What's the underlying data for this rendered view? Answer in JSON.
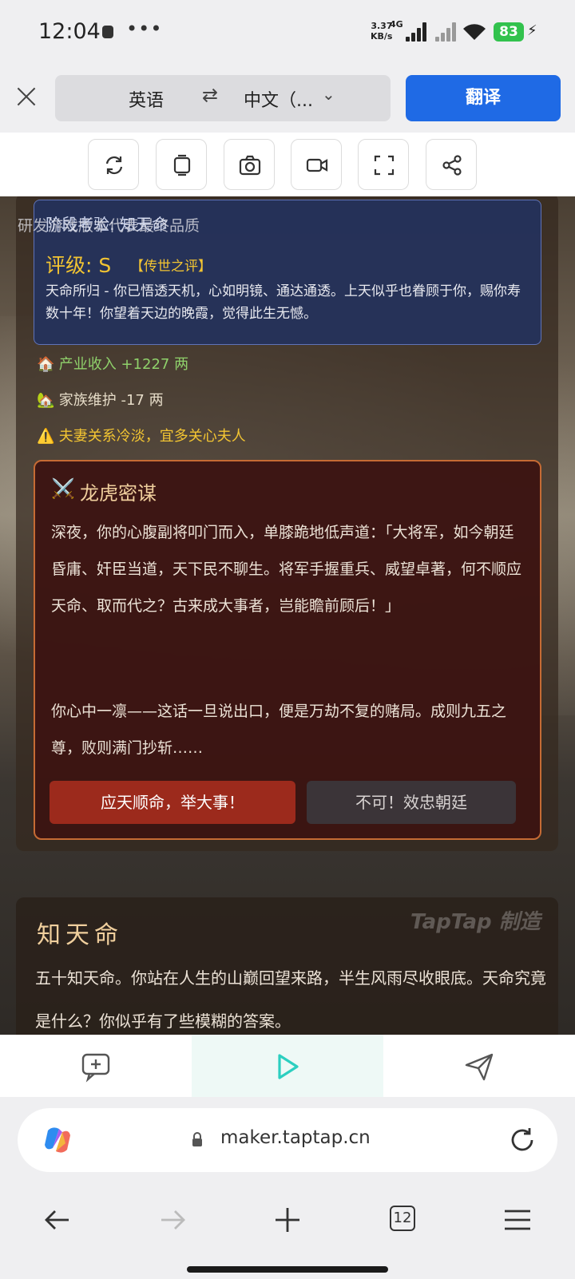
{
  "status_bar": {
    "time": "12:04",
    "more": "•••",
    "speed_top": "3.37",
    "speed_bottom": "KB/s",
    "network": "4G",
    "battery": "83",
    "battery_color": "#32c24d"
  },
  "translate_bar": {
    "source_lang": "英语",
    "swap_icon": "⇄",
    "target_lang": "中文（...",
    "translate_label": "翻译",
    "accent": "#1f6ae5"
  },
  "tools": [
    "refresh-icon",
    "layers-icon",
    "camera-icon",
    "video-icon",
    "fullscreen-icon",
    "share-icon"
  ],
  "game": {
    "watermark_top": "研发游戏版本代表最终品质",
    "evaluation": {
      "title": "阶段考验: 知天命",
      "grade": "评级: S",
      "grade_tag": "【传世之评】",
      "description": "天命所归 - 你已悟透天机，心如明镜、通达通透。上天似乎也眷顾于你，赐你寿数十年！你望着天边的晚霞，觉得此生无憾。"
    },
    "stats": {
      "income_icon": "🏠",
      "income": "产业收入 +1227 两",
      "family_icon": "🏡",
      "family": "家族维护 -17 两",
      "warning_icon": "⚠️",
      "warning": "夫妻关系冷淡，宜多关心夫人"
    },
    "event": {
      "icon": "⚔️",
      "title": "龙虎密谋",
      "paragraph1": "深夜，你的心腹副将叩门而入，单膝跪地低声道：「大将军，如今朝廷昏庸、奸臣当道，天下民不聊生。将军手握重兵、威望卓著，何不顺应天命、取而代之？古来成大事者，岂能瞻前顾后！」",
      "paragraph2": "你心中一凛——这话一旦说出口，便是万劫不复的赌局。成则九五之尊，败则满门抄斩……",
      "choice_a": "应天顺命，举大事！",
      "choice_b": "不可！效忠朝廷"
    },
    "chapter": {
      "title": "知天命",
      "text": "五十知天命。你站在人生的山巅回望来路，半生风雨尽收眼底。天命究竟是什么？你似乎有了些模糊的答案。"
    },
    "taptap_watermark": "TapTap 制造"
  },
  "app_bar": {
    "left_icon": "comment-add-icon",
    "middle_icon": "play-icon",
    "right_icon": "send-icon",
    "play_color": "#2ccfc0"
  },
  "url_bar": {
    "url": "maker.taptap.cn"
  },
  "nav": {
    "tabs_count": "12"
  }
}
